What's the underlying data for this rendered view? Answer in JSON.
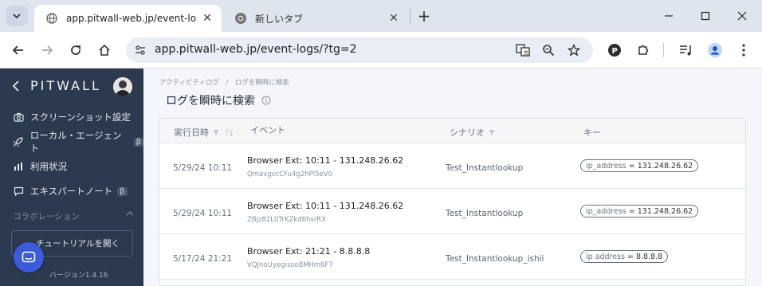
{
  "browser": {
    "tabs": [
      {
        "title": "app.pitwall-web.jp/event-logs/?",
        "active": true
      },
      {
        "title": "新しいタブ",
        "active": false
      }
    ],
    "url": "app.pitwall-web.jp/event-logs/?tg=2",
    "new_tab_label": "+"
  },
  "sidebar": {
    "logo": "PITWALL",
    "items": [
      {
        "label": "スクリーンショット設定",
        "icon": "camera-icon"
      },
      {
        "label": "ローカル・エージェント",
        "icon": "rocket-icon",
        "badge": "β"
      },
      {
        "label": "利用状況",
        "icon": "bar-chart-icon"
      },
      {
        "label": "エキスパートノート",
        "icon": "chat-icon",
        "badge": "β"
      }
    ],
    "section_label": "コラボレーション",
    "tutorial_button": "チュートリアルを開く",
    "version": "バージョン1.4.16"
  },
  "main": {
    "breadcrumb": "アクティビティログ　/　ログを瞬時に検索",
    "title": "ログを瞬時に検索",
    "columns": {
      "date": "実行日時",
      "event": "イベント",
      "scenario": "シナリオ",
      "key": "キー"
    },
    "rows": [
      {
        "date": "5/29/24 10:11",
        "event": "Browser Ext: 10:11 - 131.248.26.62",
        "id": "QmavgvcCFu4g2hPl5eV0",
        "scenario": "Test_Instantlookup",
        "key_name": "ip_address",
        "key_value": "= 131.248.26.62"
      },
      {
        "date": "5/29/24 10:11",
        "event": "Browser Ext: 10:11 - 131.248.26.62",
        "id": "ZBjz82L0TrKZkd6hsrRX",
        "scenario": "Test_Instantlookup",
        "key_name": "ip_address",
        "key_value": "= 131.248.26.62"
      },
      {
        "date": "5/17/24 21:21",
        "event": "Browser Ext: 21:21 - 8.8.8.8",
        "id": "VQJnoUyegisoo8MHm6F7",
        "scenario": "Test_Instantlookup_ishii",
        "key_name": "ip address",
        "key_value": "= 8.8.8.8"
      }
    ]
  },
  "colors": {
    "sidebar_bg": "#2b3a4e",
    "accent": "#3b5bdb",
    "chrome_bg": "#dfe5ee"
  }
}
